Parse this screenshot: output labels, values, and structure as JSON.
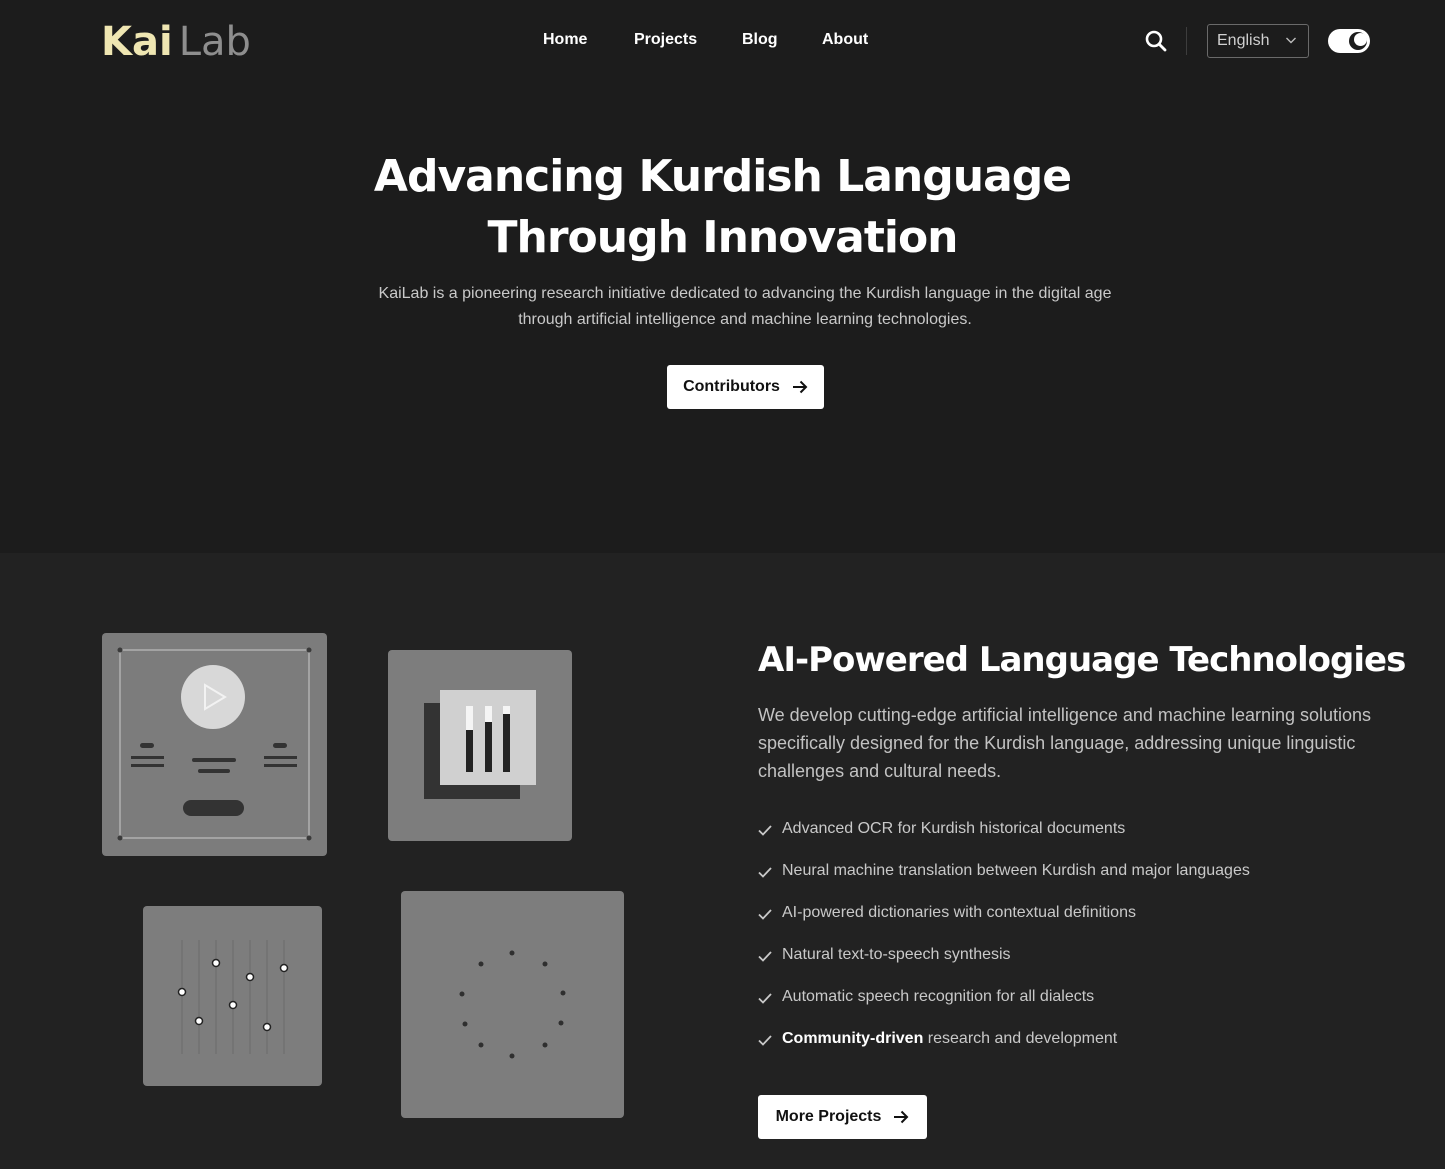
{
  "brand": {
    "part1": "Kai",
    "part2": "Lab"
  },
  "nav": {
    "items": [
      "Home",
      "Projects",
      "Blog",
      "About"
    ]
  },
  "header": {
    "search_icon": "search-icon",
    "language": "English",
    "theme_toggle_icon": "moon-icon"
  },
  "hero": {
    "title_line1": "Advancing Kurdish Language",
    "title_line2": "Through Innovation",
    "subtitle": "KaiLab is a pioneering research initiative dedicated to advancing the Kurdish language in the digital age through artificial intelligence and machine learning technologies.",
    "cta_label": "Contributors"
  },
  "tech": {
    "title": "AI-Powered Language Technologies",
    "description": "We develop cutting-edge artificial intelligence and machine learning solutions specifically designed for the Kurdish language, addressing unique linguistic challenges and cultural needs.",
    "features": [
      {
        "bold": "",
        "text": "Advanced OCR for Kurdish historical documents"
      },
      {
        "bold": "",
        "text": "Neural machine translation between Kurdish and major languages"
      },
      {
        "bold": "",
        "text": "AI-powered dictionaries with contextual definitions"
      },
      {
        "bold": "",
        "text": "Natural text-to-speech synthesis"
      },
      {
        "bold": "",
        "text": "Automatic speech recognition for all dialects"
      },
      {
        "bold": "Community-driven",
        "text": " research and development"
      }
    ],
    "cta_label": "More Projects"
  },
  "colors": {
    "accent_logo": "#efe6b2",
    "background": "#1c1c1c",
    "section_bg": "#222222",
    "card": "#7d7d7d"
  }
}
